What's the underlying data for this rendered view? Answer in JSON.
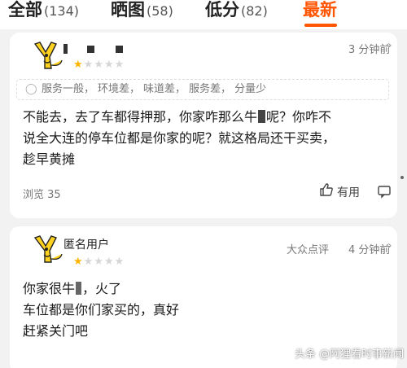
{
  "tabs": [
    {
      "label": "全部",
      "count": "(134)"
    },
    {
      "label": "晒图",
      "count": "(58)"
    },
    {
      "label": "低分",
      "count": "(82)"
    },
    {
      "label": "最新",
      "count": ""
    }
  ],
  "colors": {
    "accent": "#ff5500",
    "star_on": "#ffb400",
    "star_off": "#d6d6d6"
  },
  "reviews": [
    {
      "user": "",
      "time": "3 分钟前",
      "rating": 1,
      "tags": [
        "服务一般，",
        "环境差，",
        "味道差，",
        "服务差，",
        "分量少"
      ],
      "lines": [
        "不能去，去了车都得押那，你家咋那么牛",
        "呢？你咋不",
        "说全大连的停车位都是你家的呢？就这格局还干买卖，",
        "趁早黄摊"
      ],
      "views": "浏览 35",
      "useful": "有用",
      "icons": [
        "thumbs-up-icon",
        "comment-icon"
      ]
    },
    {
      "user": "匿名用户",
      "source": "大众点评",
      "time": "4 分钟前",
      "rating": 1,
      "lines": [
        "你家很牛",
        "，火了",
        "车位都是你们家买的，真好",
        "赶紧关门吧"
      ]
    }
  ],
  "watermark": "头条 @阿狸看时事新闻"
}
